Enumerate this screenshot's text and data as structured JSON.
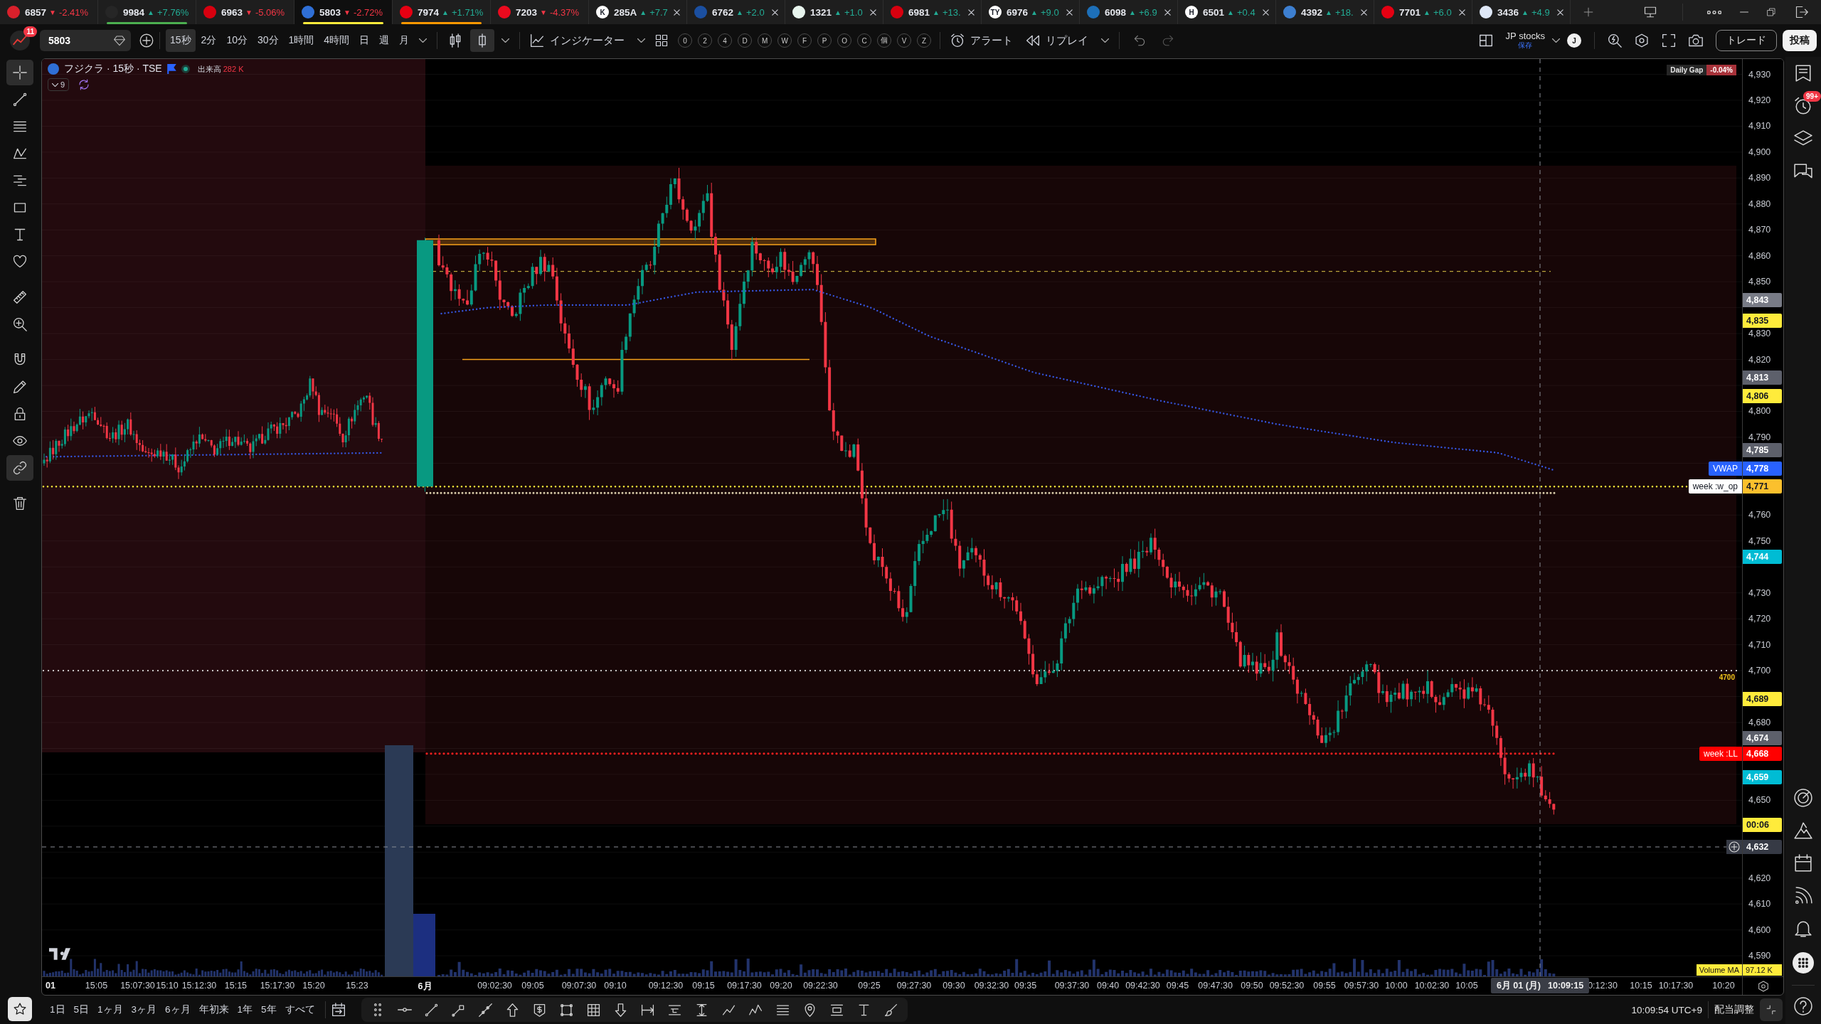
{
  "tabs": [
    {
      "symbol": "6857",
      "arrow": "▼",
      "rising": false,
      "change": "-2.41%",
      "selected": false,
      "closable": false,
      "logo": {
        "color": "#d9202b"
      }
    },
    {
      "symbol": "9984",
      "arrow": "▲",
      "rising": true,
      "change": "+7.76%",
      "selected": false,
      "closable": false,
      "color": "#4caf50",
      "logo": {
        "color": "#262626"
      }
    },
    {
      "symbol": "6963",
      "arrow": "▼",
      "rising": false,
      "change": "-5.06%",
      "selected": false,
      "closable": false,
      "logo": {
        "color": "#d7000f"
      }
    },
    {
      "symbol": "5803",
      "arrow": "▼",
      "rising": false,
      "change": "-2.72%",
      "selected": true,
      "closable": false,
      "color": "#ffeb3b",
      "logo": {
        "color": "#2f6fd6"
      }
    },
    {
      "symbol": "7974",
      "arrow": "▲",
      "rising": true,
      "change": "+1.71%",
      "selected": false,
      "closable": false,
      "color": "#ff9800",
      "logo": {
        "color": "#e60012"
      }
    },
    {
      "symbol": "7203",
      "arrow": "▼",
      "rising": false,
      "change": "-4.37%",
      "selected": false,
      "closable": false,
      "logo": {
        "color": "#eb0a1e"
      }
    },
    {
      "symbol": "285A",
      "arrow": "▲",
      "rising": true,
      "change": "+7.7",
      "selected": false,
      "closable": true,
      "logo": {
        "color": "#ffffff",
        "text": "K"
      }
    },
    {
      "symbol": "6762",
      "arrow": "▲",
      "rising": true,
      "change": "+2.0",
      "selected": false,
      "closable": true,
      "logo": {
        "color": "#1b4fa0"
      }
    },
    {
      "symbol": "1321",
      "arrow": "▲",
      "rising": true,
      "change": "+1.0",
      "selected": false,
      "closable": true,
      "logo": {
        "color": "#e8f5ee"
      }
    },
    {
      "symbol": "6981",
      "arrow": "▲",
      "rising": true,
      "change": "+13.",
      "selected": false,
      "closable": true,
      "logo": {
        "color": "#d7000f"
      }
    },
    {
      "symbol": "6976",
      "arrow": "▲",
      "rising": true,
      "change": "+9.0",
      "selected": false,
      "closable": true,
      "logo": {
        "color": "#ffffff",
        "text": "TY"
      }
    },
    {
      "symbol": "6098",
      "arrow": "▲",
      "rising": true,
      "change": "+6.9",
      "selected": false,
      "closable": true,
      "logo": {
        "color": "#1d6fb8"
      }
    },
    {
      "symbol": "6501",
      "arrow": "▲",
      "rising": true,
      "change": "+0.4",
      "selected": false,
      "closable": true,
      "logo": {
        "color": "#ffffff",
        "text": "H"
      }
    },
    {
      "symbol": "4392",
      "arrow": "▲",
      "rising": true,
      "change": "+18.",
      "selected": false,
      "closable": true,
      "logo": {
        "color": "#3d7fd0"
      }
    },
    {
      "symbol": "7701",
      "arrow": "▲",
      "rising": true,
      "change": "+6.0",
      "selected": false,
      "closable": true,
      "logo": {
        "color": "#e50012"
      }
    },
    {
      "symbol": "3436",
      "arrow": "▲",
      "rising": true,
      "change": "+4.9",
      "selected": false,
      "closable": true,
      "logo": {
        "color": "#dfe8f7"
      }
    }
  ],
  "toolbar": {
    "notification_count": "11",
    "symbol": "5803",
    "intervals": [
      {
        "label": "15秒",
        "selected": true
      },
      {
        "label": "2分",
        "selected": false
      },
      {
        "label": "10分",
        "selected": false
      },
      {
        "label": "30分",
        "selected": false
      },
      {
        "label": "1時間",
        "selected": false
      },
      {
        "label": "4時間",
        "selected": false
      },
      {
        "label": "日",
        "selected": false
      },
      {
        "label": "週",
        "selected": false
      },
      {
        "label": "月",
        "selected": false
      }
    ],
    "chart_types": [
      {
        "kind": "candles",
        "selected": false
      },
      {
        "kind": "candle",
        "selected": true
      }
    ],
    "indicators": "インジケーター",
    "indicator_shortcuts": [
      "0",
      "2",
      "4",
      "D",
      "M",
      "W",
      "F",
      "P",
      "O",
      "C",
      "個",
      "V",
      "Z"
    ],
    "alert": "アラート",
    "replay": "リプレイ",
    "layout_name": "JP stocks",
    "save_state": "保存",
    "user_initial": "J",
    "trade": "トレード",
    "publish": "投稿"
  },
  "drawing_toolbar": [
    {
      "kind": "crosshair",
      "selected": true
    },
    {
      "kind": "trendline",
      "selected": false
    },
    {
      "kind": "hlines",
      "selected": false
    },
    {
      "kind": "zigzag",
      "selected": false
    },
    {
      "kind": "lines",
      "selected": false
    },
    {
      "kind": "rectangle",
      "selected": false
    },
    {
      "kind": "text",
      "selected": false
    },
    {
      "kind": "heart",
      "selected": false
    },
    {
      "kind": "ruler",
      "selected": false
    },
    {
      "kind": "zoom",
      "selected": false
    },
    {
      "kind": "magnet",
      "selected": false
    },
    {
      "kind": "pencil",
      "selected": false
    },
    {
      "kind": "lock",
      "selected": false
    },
    {
      "kind": "eye",
      "selected": false
    },
    {
      "kind": "link",
      "selected": true
    },
    {
      "kind": "trash",
      "selected": false
    }
  ],
  "chart": {
    "legend": {
      "logo": {
        "color": "#2f6fd6"
      },
      "title": "フジクラ · 15秒 · TSE",
      "market_open": true,
      "volume_label": "出来高",
      "volume": "282 K",
      "hidden_indicators": "9"
    },
    "daily_gap": {
      "label": "Daily Gap",
      "value": "-0.04%"
    },
    "level_label": "4700",
    "price_ticks": [
      "4,930",
      "4,920",
      "4,910",
      "4,900",
      "4,890",
      "4,880",
      "4,870",
      "4,860",
      "4,850",
      "4,830",
      "4,820",
      "4,800",
      "4,790",
      "4,760",
      "4,750",
      "4,730",
      "4,720",
      "4,710",
      "4,700",
      "4,680",
      "4,650",
      "4,620",
      "4,610",
      "4,600",
      "4,590"
    ],
    "price_badges": [
      {
        "kind": "price",
        "value": "4,843",
        "color": "#787b86"
      },
      {
        "kind": "price",
        "value": "4,835",
        "color": "#ffeb3b"
      },
      {
        "kind": "price",
        "value": "4,813",
        "color": "#5d606b"
      },
      {
        "kind": "price",
        "value": "4,806",
        "color": "#ffeb3b"
      },
      {
        "kind": "price",
        "value": "4,785",
        "color": "#5d606b"
      },
      {
        "kind": "price",
        "value": "4,778",
        "color": "#2962ff",
        "tag": {
          "text": "VWAP",
          "color": "#2962ff"
        }
      },
      {
        "kind": "price",
        "value": "4,771",
        "color": "#fbc02d",
        "tag": {
          "text": "week :w_op",
          "color": "#ffffff"
        }
      },
      {
        "kind": "price",
        "value": "4,744",
        "color": "#00bcd4"
      },
      {
        "kind": "price",
        "value": "4,689",
        "color": "#ffeb3b"
      },
      {
        "kind": "price",
        "value": "4,674",
        "color": "#5d606b"
      },
      {
        "kind": "price",
        "value": "4,668",
        "color": "#ff0000",
        "tag": {
          "text": "week :LL",
          "color": "#ff0000"
        }
      },
      {
        "kind": "price",
        "value": "4,659",
        "color": "#00bcd4"
      },
      {
        "kind": "price",
        "value": "00:06",
        "color": "#ffeb3b"
      },
      {
        "kind": "crosshair",
        "value": "4,632",
        "color": "#363a45"
      }
    ],
    "volume_ma": {
      "label": "Volume MA",
      "value": "97.12 K"
    },
    "time_ticks": [
      {
        "label": "01",
        "major": true
      },
      {
        "label": "15:05",
        "major": false
      },
      {
        "label": "15:07:30",
        "major": false
      },
      {
        "label": "15:10",
        "major": false
      },
      {
        "label": "15:12:30",
        "major": false
      },
      {
        "label": "15:15",
        "major": false
      },
      {
        "label": "15:17:30",
        "major": false
      },
      {
        "label": "15:20",
        "major": false
      },
      {
        "label": "15:23",
        "major": false
      },
      {
        "label": "6月",
        "major": true
      },
      {
        "label": "09:02:30",
        "major": false
      },
      {
        "label": "09:05",
        "major": false
      },
      {
        "label": "09:07:30",
        "major": false
      },
      {
        "label": "09:10",
        "major": false
      },
      {
        "label": "09:12:30",
        "major": false
      },
      {
        "label": "09:15",
        "major": false
      },
      {
        "label": "09:17:30",
        "major": false
      },
      {
        "label": "09:20",
        "major": false
      },
      {
        "label": "09:22:30",
        "major": false
      },
      {
        "label": "09:25",
        "major": false
      },
      {
        "label": "09:27:30",
        "major": false
      },
      {
        "label": "09:30",
        "major": false
      },
      {
        "label": "09:32:30",
        "major": false
      },
      {
        "label": "09:35",
        "major": false
      },
      {
        "label": "09:37:30",
        "major": false
      },
      {
        "label": "09:40",
        "major": false
      },
      {
        "label": "09:42:30",
        "major": false
      },
      {
        "label": "09:45",
        "major": false
      },
      {
        "label": "09:47:30",
        "major": false
      },
      {
        "label": "09:50",
        "major": false
      },
      {
        "label": "09:52:30",
        "major": false
      },
      {
        "label": "09:55",
        "major": false
      },
      {
        "label": "09:57:30",
        "major": false
      },
      {
        "label": "10:00",
        "major": false
      },
      {
        "label": "10:02:30",
        "major": false
      },
      {
        "label": "10:05",
        "major": false
      },
      {
        "label": "0:12:30",
        "major": false
      },
      {
        "label": "10:15",
        "major": false
      },
      {
        "label": "10:17:30",
        "major": false
      },
      {
        "label": "10:20",
        "major": false
      }
    ],
    "crosshair_date": "6月 01 (月)",
    "crosshair_time": "10:09:15"
  },
  "sidebar": {
    "alerts_badge": "99+"
  },
  "bottom_bar": {
    "ranges": [
      "1日",
      "5日",
      "1ヶ月",
      "3ヶ月",
      "6ヶ月",
      "年初来",
      "1年",
      "5年",
      "すべて"
    ],
    "clock": "10:09:54 UTC+9",
    "adjustment": "配当調整"
  }
}
